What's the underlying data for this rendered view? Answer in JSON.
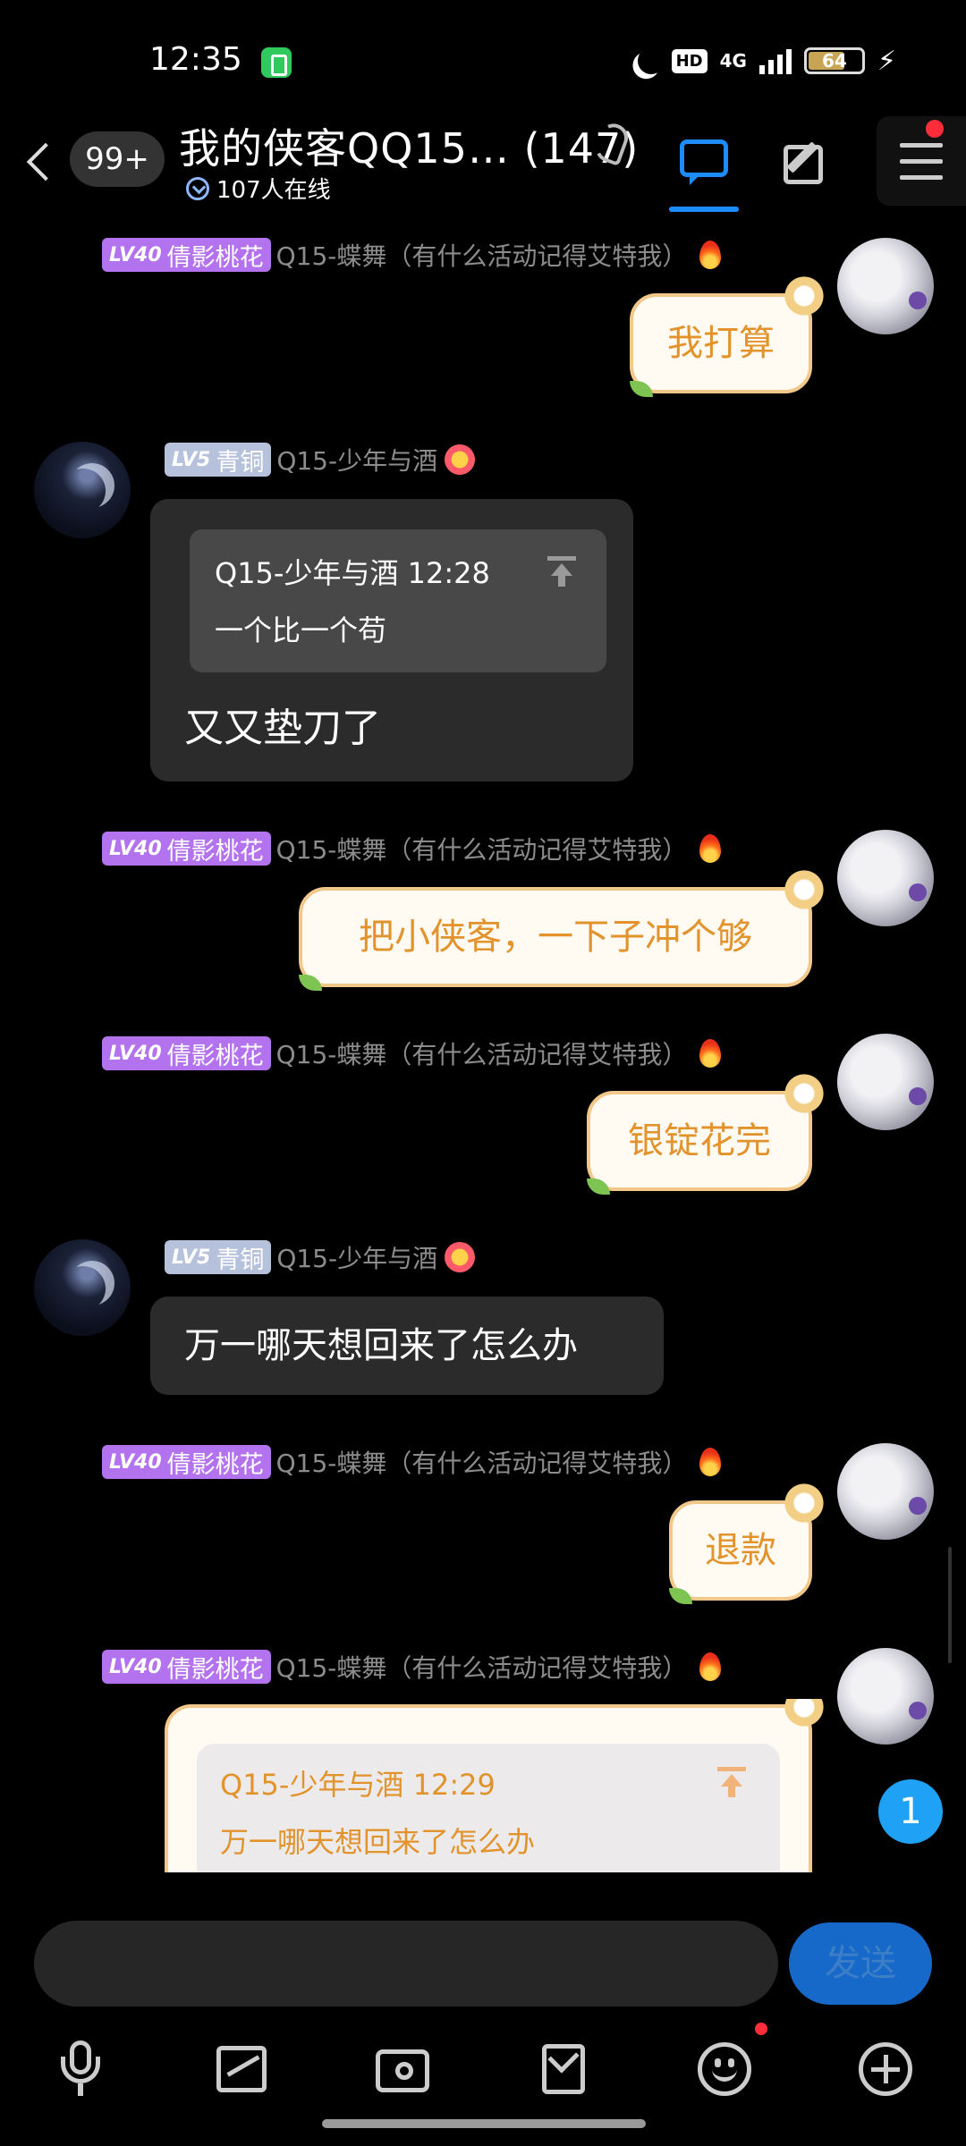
{
  "status_bar": {
    "time": "12:35",
    "hd": "HD",
    "network": "4G",
    "battery": "64"
  },
  "header": {
    "unread_count": "99+",
    "title": "我的侠客QQ15…  (147)",
    "online": "107人在线"
  },
  "messages": [
    {
      "badge_level": "LV40",
      "badge_name": "倩影桃花",
      "sender": "Q15-蝶舞（有什么活动记得艾特我）",
      "text": "我打算"
    },
    {
      "badge_level": "LV5",
      "badge_name": "青铜",
      "sender": "Q15-少年与酒",
      "quote_head": "Q15-少年与酒 12:28",
      "quote_text": "一个比一个苟",
      "text": "又又垫刀了"
    },
    {
      "badge_level": "LV40",
      "badge_name": "倩影桃花",
      "sender": "Q15-蝶舞（有什么活动记得艾特我）",
      "text": "把小侠客，一下子冲个够"
    },
    {
      "badge_level": "LV40",
      "badge_name": "倩影桃花",
      "sender": "Q15-蝶舞（有什么活动记得艾特我）",
      "text": "银锭花完"
    },
    {
      "badge_level": "LV5",
      "badge_name": "青铜",
      "sender": "Q15-少年与酒",
      "text": "万一哪天想回来了怎么办"
    },
    {
      "badge_level": "LV40",
      "badge_name": "倩影桃花",
      "sender": "Q15-蝶舞（有什么活动记得艾特我）",
      "text": "退款"
    },
    {
      "badge_level": "LV40",
      "badge_name": "倩影桃花",
      "sender": "Q15-蝶舞（有什么活动记得艾特我）",
      "quote_head": "Q15-少年与酒 12:29",
      "quote_text": "万一哪天想回来了怎么办"
    }
  ],
  "new_message_count": "1",
  "composer": {
    "input_value": "",
    "send_label": "发送"
  },
  "toolbar_icons": [
    "mic-icon",
    "image-icon",
    "camera-icon",
    "red-packet-icon",
    "emoji-icon",
    "plus-icon"
  ],
  "colors": {
    "accent_blue": "#1d8cff",
    "self_bubble_text": "#e2932c",
    "badge_purple": "#b473ee"
  }
}
